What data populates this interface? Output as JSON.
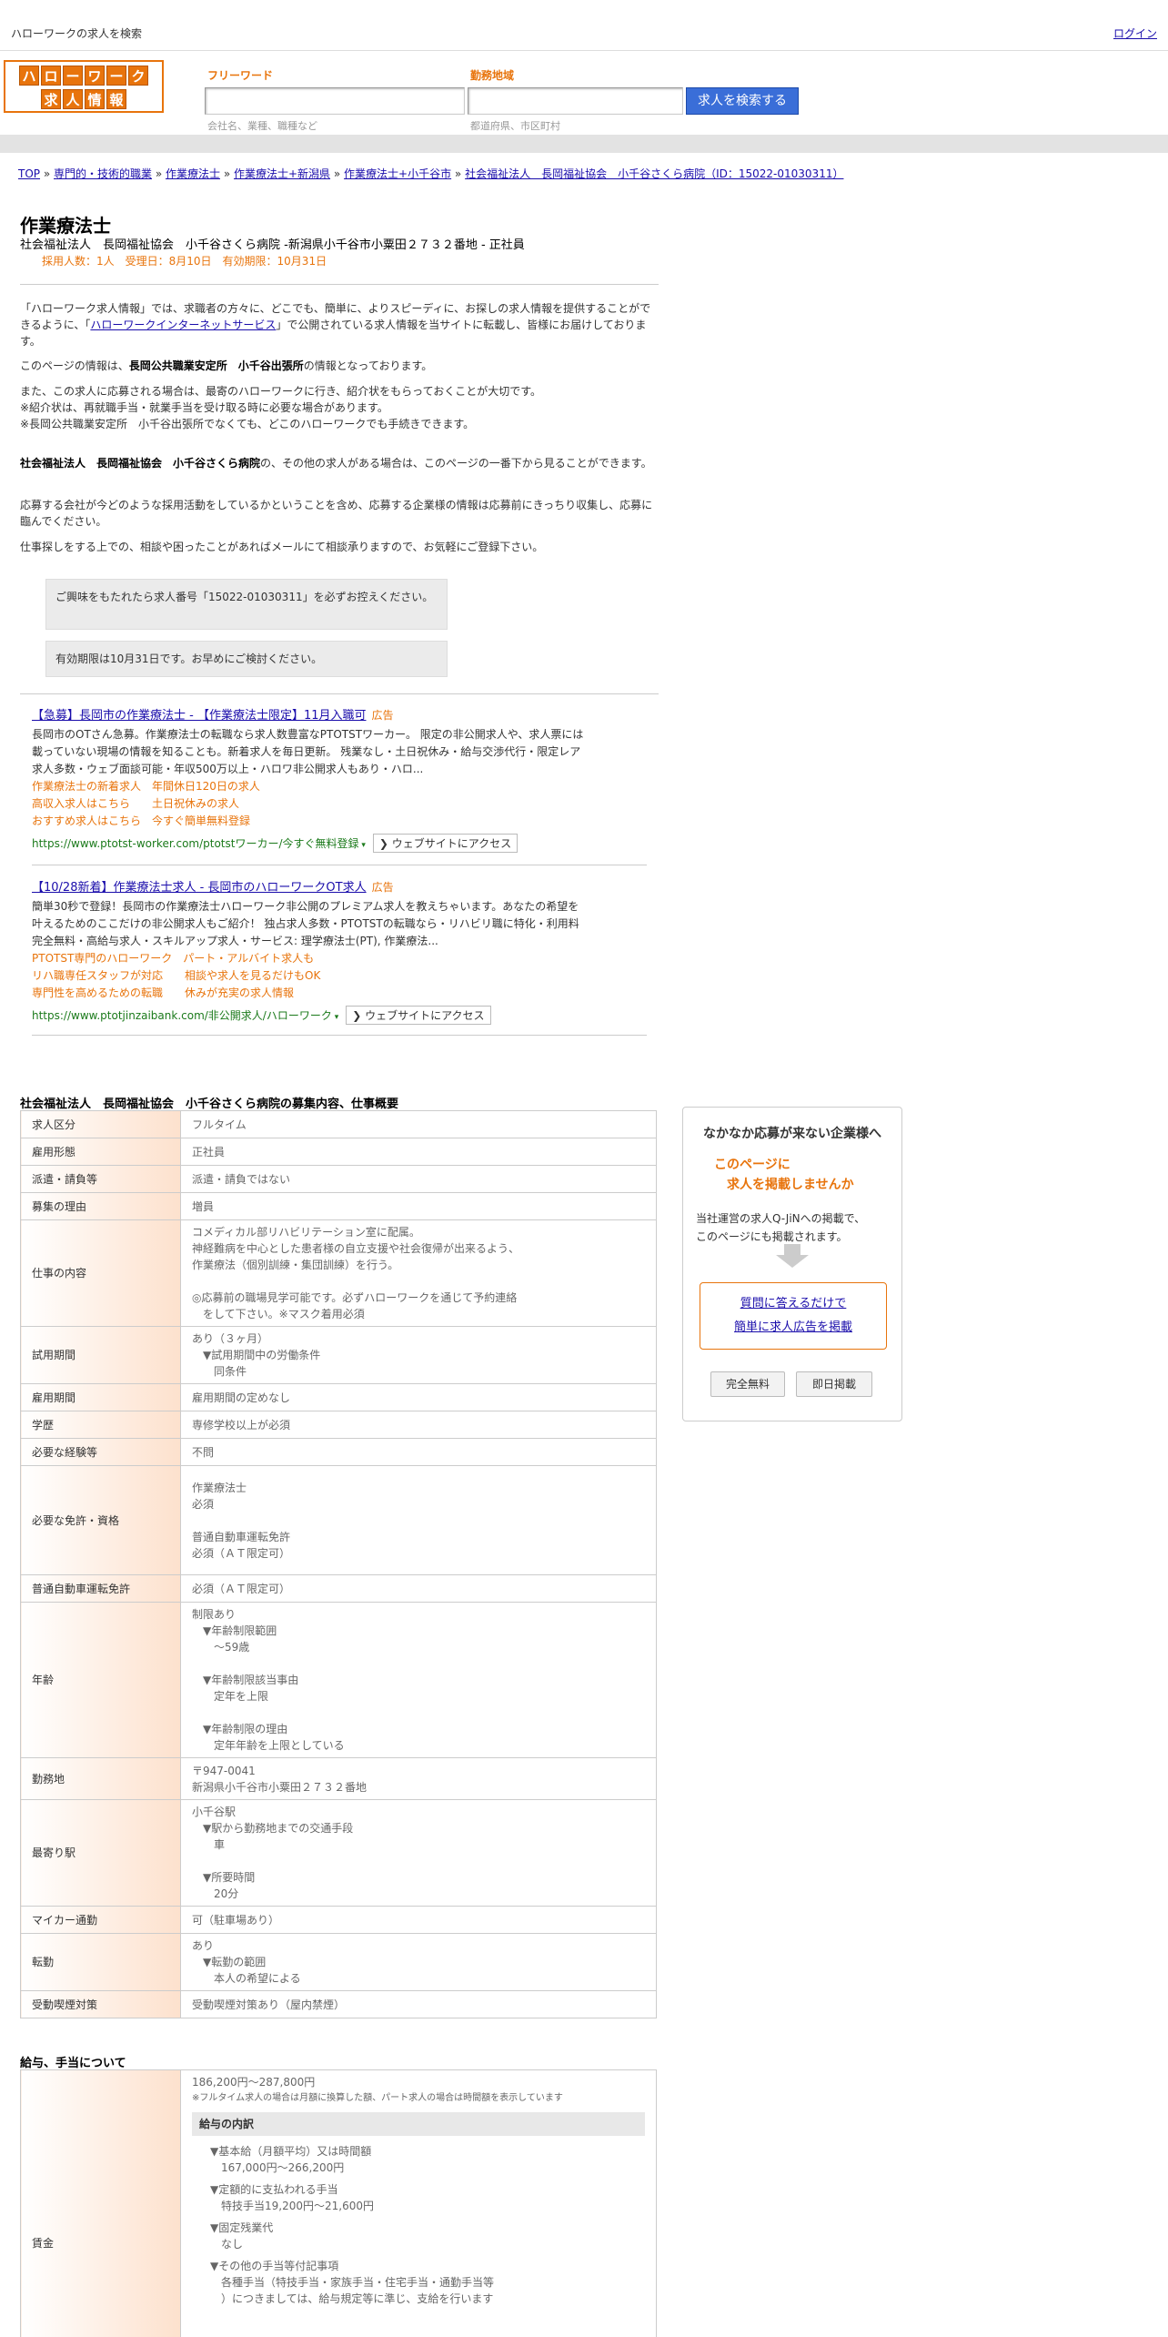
{
  "topbar": {
    "title": "ハローワークの求人を検索",
    "login": "ログイン"
  },
  "logo": {
    "row1": [
      "ハ",
      "ロ",
      "ー",
      "ワ",
      "ー",
      "ク"
    ],
    "row2": [
      "求",
      "人",
      "情",
      "報"
    ]
  },
  "search": {
    "free_label": "フリーワード",
    "free_placeholder": "会社名、業種、職種など",
    "area_label": "勤務地域",
    "area_placeholder": "都道府県、市区町村",
    "button": "求人を検索する"
  },
  "breadcrumb": [
    "TOP",
    "専門的・技術的職業",
    "作業療法士",
    "作業療法士+新潟県",
    "作業療法士+小千谷市",
    "社会福祉法人　長岡福祉協会　小千谷さくら病院（ID：15022-01030311）"
  ],
  "job": {
    "title": "作業療法士",
    "subtitle": "社会福祉法人　長岡福祉協会　小千谷さくら病院 -新潟県小千谷市小粟田２７３２番地 - 正社員",
    "meta": "採用人数：1人　受理日：8月10日　有効期限：10月31日"
  },
  "intro": {
    "p1_a": "「ハローワーク求人情報」では、求職者の方々に、どこでも、簡単に、よりスピーディに、お探しの求人情報を提供することができるように、「",
    "p1_link": "ハローワークインターネットサービス",
    "p1_b": "」で公開されている求人情報を当サイトに転載し、皆様にお届けしております。",
    "p2_a": "このページの情報は、",
    "p2_b": "長岡公共職業安定所　小千谷出張所",
    "p2_c": "の情報となっております。",
    "p3_1": "また、この求人に応募される場合は、最寄のハローワークに行き、紹介状をもらっておくことが大切です。",
    "p3_2": "※紹介状は、再就職手当・就業手当を受け取る時に必要な場合があります。",
    "p3_3": "※長岡公共職業安定所　小千谷出張所でなくても、どこのハローワークでも手続きできます。",
    "p4_a": "社会福祉法人　長岡福祉協会　小千谷さくら病院",
    "p4_b": "の、その他の求人がある場合は、このページの一番下から見ることができます。",
    "p5": "応募する会社が今どのような採用活動をしているかということを含め、応募する企業様の情報は応募前にきっちり収集し、応募に臨んでください。",
    "p6": "仕事探しをする上での、相談や困ったことがあればメールにて相談承りますので、お気軽にご登録下さい。",
    "note1": "ご興味をもたれたら求人番号「15022-01030311」を必ずお控えください。",
    "note2": "有効期限は10月31日です。お早めにご検討ください。"
  },
  "ads": [
    {
      "headline": "【急募】長岡市の作業療法士 - 【作業療法士限定】11月入職可",
      "tag": "広告",
      "desc": "長岡市のOTさん急募。作業療法士の転職なら求人数豊富なPTOTSTワーカー。 限定の非公開求人や、求人票には載っていない現場の情報を知ることも。新着求人を毎日更新。 残業なし・土日祝休み・給与交渉代行・限定レア求人多数・ウェブ面談可能・年収500万以上・ハロワ非公開求人もあり・ハロ...",
      "sitelinks": [
        "作業療法士の新着求人　年間休日120日の求人",
        "高収入求人はこちら　　土日祝休みの求人",
        "おすすめ求人はこちら　今すぐ簡単無料登録"
      ],
      "url": "https://www.ptotst-worker.com/ptotstワーカー/今すぐ無料登録",
      "visit": "❯ ウェブサイトにアクセス"
    },
    {
      "headline": "【10/28新着】作業療法士求人 - 長岡市のハローワークOT求人",
      "tag": "広告",
      "desc": "簡単30秒で登録！長岡市の作業療法士ハローワーク非公開のプレミアム求人を教えちゃいます。あなたの希望を叶えるためのここだけの非公開求人もご紹介！ 独占求人多数・PTOTSTの転職なら・リハビリ職に特化・利用料完全無料・高給与求人・スキルアップ求人・サービス: 理学療法士(PT), 作業療法...",
      "sitelinks": [
        "PTOTST専門のハローワーク　パート・アルバイト求人も",
        "リハ職専任スタッフが対応　　相談や求人を見るだけもOK",
        "専門性を高めるための転職　　休みが充実の求人情報"
      ],
      "url": "https://www.ptotjinzaibank.com/非公開求人/ハローワーク",
      "visit": "❯ ウェブサイトにアクセス"
    }
  ],
  "details": {
    "heading": "社会福祉法人　長岡福祉協会　小千谷さくら病院の募集内容、仕事概要",
    "rows": [
      {
        "label": "求人区分",
        "value": "フルタイム"
      },
      {
        "label": "雇用形態",
        "value": "正社員"
      },
      {
        "label": "派遣・請負等",
        "value": "派遣・請負ではない"
      },
      {
        "label": "募集の理由",
        "value": "増員"
      },
      {
        "label": "仕事の内容",
        "value": "コメディカル部リハビリテーション室に配属。\n神経難病を中心とした患者様の自立支援や社会復帰が出来るよう、\n作業療法（個別訓練・集団訓練）を行う。\n\n◎応募前の職場見学可能です。必ずハローワークを通じて予約連絡\n　をして下さい。※マスク着用必須"
      },
      {
        "label": "試用期間",
        "value": "あり（３ヶ月）\n　▼試用期間中の労働条件\n　　同条件"
      },
      {
        "label": "雇用期間",
        "value": "雇用期間の定めなし"
      },
      {
        "label": "学歴",
        "value": "専修学校以上が必須"
      },
      {
        "label": "必要な経験等",
        "value": "不問"
      },
      {
        "label": "必要な免許・資格",
        "value": "作業療法士\n必須\n\n普通自動車運転免許\n必須（ＡＴ限定可）\n"
      },
      {
        "label": "普通自動車運転免許",
        "value": "必須（ＡＴ限定可）"
      },
      {
        "label": "年齢",
        "value": "制限あり\n　▼年齢制限範囲\n　　〜59歳\n\n　▼年齢制限該当事由\n　　定年を上限\n\n　▼年齢制限の理由\n　　定年年齢を上限としている"
      },
      {
        "label": "勤務地",
        "value": "〒947-0041\n新潟県小千谷市小粟田２７３２番地"
      },
      {
        "label": "最寄り駅",
        "value": "小千谷駅\n　▼駅から勤務地までの交通手段\n　　車\n\n　▼所要時間\n　　20分"
      },
      {
        "label": "マイカー通勤",
        "value": "可（駐車場あり）"
      },
      {
        "label": "転勤",
        "value": "あり\n　▼転勤の範囲\n　　本人の希望による"
      },
      {
        "label": "受動喫煙対策",
        "value": "受動喫煙対策あり（屋内禁煙）"
      }
    ]
  },
  "salary": {
    "heading": "給与、手当について",
    "label": "賃金",
    "range": "186,200円〜287,800円",
    "note": "※フルタイム求人の場合は月額に換算した額、パート求人の場合は時間額を表示しています",
    "breakdown_head": "給与の内訳",
    "items": [
      "▼基本給（月額平均）又は時間額\n　167,000円〜266,200円",
      "▼定額的に支払われる手当\n　特技手当19,200円〜21,600円",
      "▼固定残業代\n　なし",
      "▼その他の手当等付記事項\n　各種手当（特技手当・家族手当・住宅手当・通勤手当等\n　）につきましては、給与規定等に準じ、支給を行います"
    ]
  },
  "sidebar": {
    "title": "なかなか応募が来ない企業様へ",
    "accent1": "このページに",
    "accent2": "　求人を掲載しませんか",
    "body1": "当社運営の求人Q-JiNへの掲載で、",
    "body2": "このページにも掲載されます。",
    "link1": "質問に答えるだけで",
    "link2": "簡単に求人広告を掲載",
    "btn1": "完全無料",
    "btn2": "即日掲載"
  }
}
